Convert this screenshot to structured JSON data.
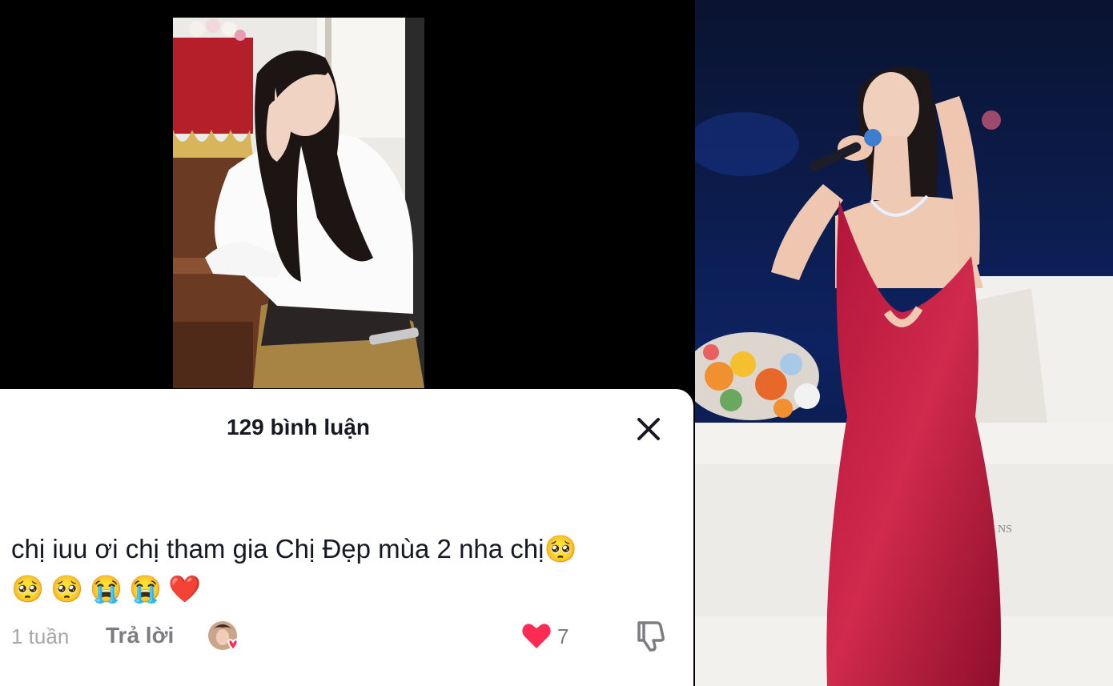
{
  "comments_panel": {
    "count_label": "129 bình luận",
    "close_icon": "close-icon"
  },
  "comment": {
    "text": "chị iuu ơi chị tham gia Chị Đẹp mùa 2 nha chị",
    "trailing_emoji": "🥺",
    "emoji_row": [
      "🥺",
      "🥺",
      "😭",
      "😭",
      "❤️"
    ],
    "time": "1 tuần",
    "reply_label": "Trả lời",
    "like_count": "7",
    "like_icon": "heart-icon",
    "dislike_icon": "thumbs-down-icon",
    "like_color": "#fe2c55"
  },
  "right_photo": {
    "piano_lettering": "NS"
  }
}
